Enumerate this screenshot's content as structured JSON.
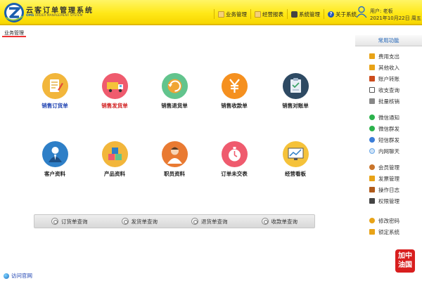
{
  "app": {
    "title": "云客订单管理系统",
    "subtitle_brand": "OMS",
    "subtitle_rest": " ORDER MANAGEMENT SYSTEM"
  },
  "topnav": [
    {
      "label": "业务管理",
      "icon": "folder-icon"
    },
    {
      "label": "经营报表",
      "icon": "folder-icon"
    },
    {
      "label": "系统管理",
      "icon": "gear-icon"
    },
    {
      "label": "关于系统",
      "icon": "help-icon"
    }
  ],
  "user": {
    "name_line": "用户: 老板",
    "date_line": "2021年10月22日 周五"
  },
  "breadcrumb": "业务管理",
  "tiles": [
    {
      "label": "销售订货单",
      "icon": "order-notebook-icon",
      "color": "#f2b63b"
    },
    {
      "label": "销售发货单",
      "icon": "delivery-truck-icon",
      "color": "#ef5b6e"
    },
    {
      "label": "销售退货单",
      "icon": "return-cycle-icon",
      "color": "#62c48d"
    },
    {
      "label": "销售收款单",
      "icon": "yuan-icon",
      "color": "#f5901f"
    },
    {
      "label": "销售对账单",
      "icon": "clipboard-icon",
      "color": "#2e4a63"
    },
    {
      "label": "客户资料",
      "icon": "customer-icon",
      "color": "#2e7fc7"
    },
    {
      "label": "产品资料",
      "icon": "product-boxes-icon",
      "color": "#f2b63b"
    },
    {
      "label": "职员资料",
      "icon": "staff-icon",
      "color": "#e97a32"
    },
    {
      "label": "订单未交表",
      "icon": "stopwatch-icon",
      "color": "#ef5b6e"
    },
    {
      "label": "经营看板",
      "icon": "dashboard-chart-icon",
      "color": "#f5c23a"
    }
  ],
  "queries": [
    {
      "label": "订货单查询"
    },
    {
      "label": "发货单查询"
    },
    {
      "label": "退货单查询"
    },
    {
      "label": "收款单查询"
    }
  ],
  "sidebar": {
    "title": "常用功能",
    "items": [
      {
        "label": "费用支出",
        "color": "#e8a317"
      },
      {
        "label": "其他收入",
        "color": "#e8a317"
      },
      {
        "label": "账户转账",
        "color": "#cc4b1c"
      },
      {
        "label": "收支查询",
        "color": "#555555"
      },
      {
        "label": "批量核销",
        "color": "#555555"
      },
      {
        "label": "微信通知",
        "color": "#2bb24c"
      },
      {
        "label": "微信群发",
        "color": "#2bb24c"
      },
      {
        "label": "短信群发",
        "color": "#3b7dd8"
      },
      {
        "label": "内网聊天",
        "color": "#6aa8e8"
      },
      {
        "label": "会员管理",
        "color": "#c9742b"
      },
      {
        "label": "发票管理",
        "color": "#e8a317"
      },
      {
        "label": "操作日志",
        "color": "#b05a1a"
      },
      {
        "label": "权限管理",
        "color": "#444444"
      },
      {
        "label": "修改密码",
        "color": "#e8a317"
      },
      {
        "label": "锁定系统",
        "color": "#e8a317"
      }
    ]
  },
  "stamp": {
    "line1": "加中",
    "line2": "油国"
  },
  "footer": {
    "link": "访问官网"
  }
}
